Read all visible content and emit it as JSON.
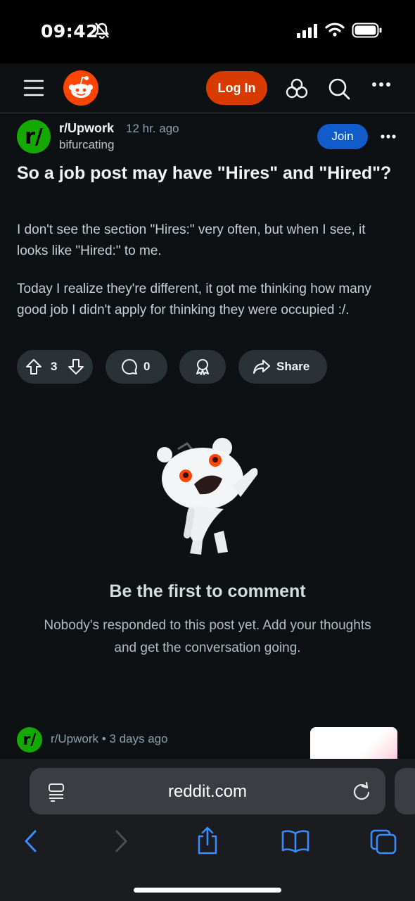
{
  "status": {
    "time": "09:42"
  },
  "header": {
    "login_label": "Log In"
  },
  "post": {
    "subreddit": "r/Upwork",
    "age": "12 hr. ago",
    "author": "bifurcating",
    "join_label": "Join",
    "title": "So a job post may have \"Hires\" and \"Hired\"?",
    "body": [
      "I don't see the section \"Hires:\" very often, but when I see, it looks like \"Hired:\" to me.",
      "Today I realize they're different, it got me thinking how many good job I didn't apply for thinking they were occupied :/."
    ],
    "votes": "3",
    "comments": "0",
    "share_label": "Share"
  },
  "empty": {
    "title": "Be the first to comment",
    "subtitle": "Nobody's responded to this post yet. Add your thoughts and get the conversation going."
  },
  "next_post": {
    "meta": "r/Upwork • 3 days ago"
  },
  "browser": {
    "url": "reddit.com"
  },
  "colors": {
    "reddit_orange": "#ff4500",
    "join_blue": "#115bca",
    "upwork_green": "#14a800",
    "ios_blue": "#3a8cff"
  }
}
